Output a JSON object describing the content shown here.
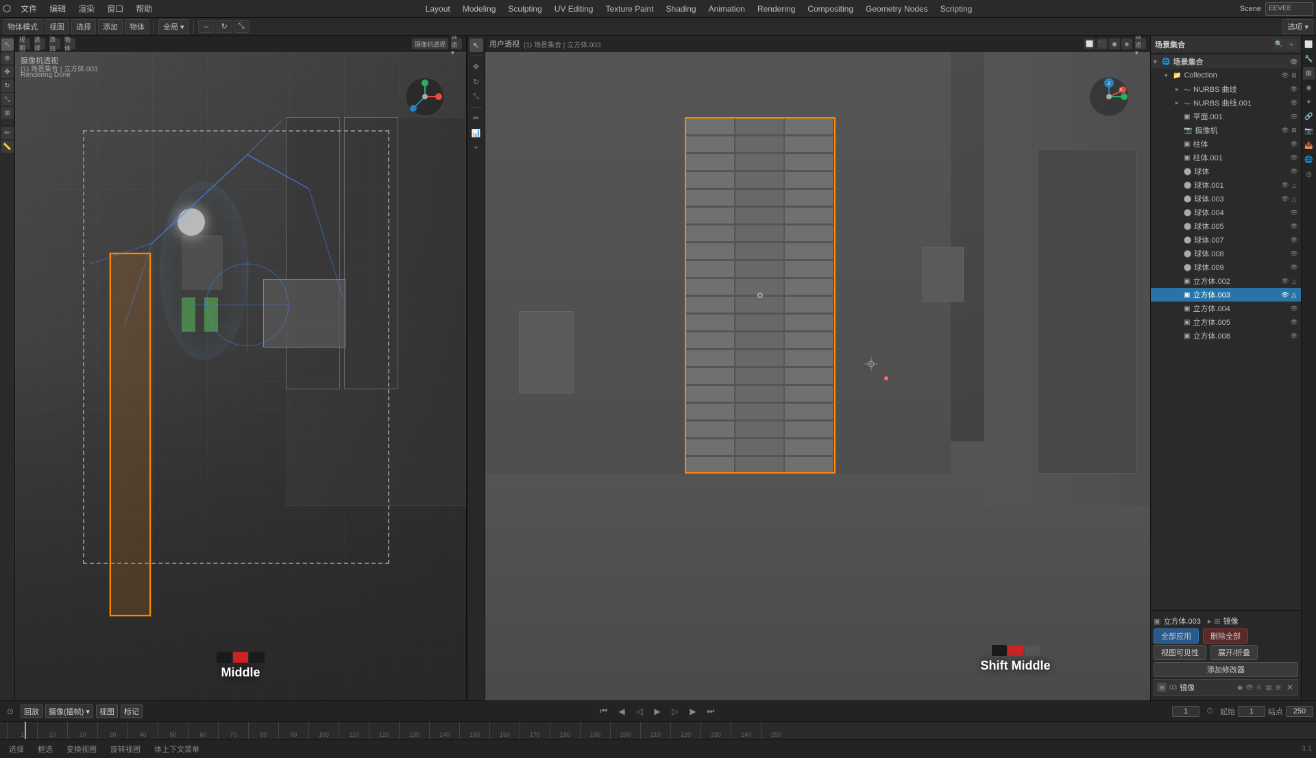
{
  "app": {
    "title": "Blender",
    "version": "3.1"
  },
  "top_menu": {
    "items": [
      "文件",
      "编辑",
      "渲染",
      "窗口",
      "帮助",
      "Layout",
      "Modeling",
      "Sculpting",
      "UV Editing",
      "Texture Paint",
      "Shading",
      "Animation",
      "Rendering",
      "Compositing",
      "Geometry Nodes",
      "Scripting"
    ]
  },
  "toolbar_left": {
    "mode_label": "物体模式",
    "view_label": "视图",
    "select_label": "选择",
    "add_label": "添加",
    "object_label": "物体"
  },
  "viewport_left": {
    "title": "摄像机透视",
    "subtitle": "(1) 场景集合 | 立方体.003",
    "status": "Rendering Done",
    "mode": "摄像机透视"
  },
  "viewport_right": {
    "title": "用户透视",
    "subtitle": "(1) 场景集合 | 立方体.003"
  },
  "timeline": {
    "mode": "回放",
    "mode2": "摄像(插帧)",
    "view": "视图",
    "marker": "标记",
    "start_frame": "1",
    "end_frame": "250",
    "current_frame": "1",
    "keyframe_label": "起始",
    "keyframe_start": "1",
    "keyframe_end": "结点",
    "keyframe_end_val": "250",
    "frame_marks": [
      "1",
      "10",
      "20",
      "30",
      "40",
      "50",
      "60",
      "70",
      "80",
      "90",
      "100",
      "110",
      "120",
      "130",
      "140",
      "150",
      "160",
      "170",
      "180",
      "190",
      "200",
      "210",
      "220",
      "230",
      "240",
      "250"
    ]
  },
  "mouse_hints": {
    "left_label": "Middle",
    "right_label": "Shift Middle"
  },
  "scene_tree": {
    "header": "场景集合",
    "items": [
      {
        "id": "collection",
        "label": "Collection",
        "depth": 0,
        "expanded": true,
        "type": "collection"
      },
      {
        "id": "nurbs_line",
        "label": "NURBS 曲线",
        "depth": 1,
        "expanded": false,
        "type": "curve"
      },
      {
        "id": "nurbs_001",
        "label": "NURBS 曲线.001",
        "depth": 1,
        "expanded": false,
        "type": "curve"
      },
      {
        "id": "plane_001",
        "label": "平面.001",
        "depth": 1,
        "expanded": false,
        "type": "mesh"
      },
      {
        "id": "camera",
        "label": "摄像机",
        "depth": 1,
        "expanded": false,
        "type": "camera"
      },
      {
        "id": "column",
        "label": "柱体",
        "depth": 1,
        "expanded": false,
        "type": "mesh"
      },
      {
        "id": "column_001",
        "label": "柱体.001",
        "depth": 1,
        "expanded": false,
        "type": "mesh"
      },
      {
        "id": "sphere_body",
        "label": "球体",
        "depth": 1,
        "expanded": false,
        "type": "mesh"
      },
      {
        "id": "sphere_001",
        "label": "球体.001",
        "depth": 1,
        "expanded": false,
        "type": "mesh"
      },
      {
        "id": "sphere_003",
        "label": "球体.003",
        "depth": 1,
        "expanded": false,
        "type": "mesh"
      },
      {
        "id": "sphere_004",
        "label": "球体.004",
        "depth": 1,
        "expanded": false,
        "type": "mesh"
      },
      {
        "id": "sphere_005",
        "label": "球体.005",
        "depth": 1,
        "expanded": false,
        "type": "mesh"
      },
      {
        "id": "sphere_007",
        "label": "球体.007",
        "depth": 1,
        "expanded": false,
        "type": "mesh"
      },
      {
        "id": "sphere_008",
        "label": "球体.008",
        "depth": 1,
        "expanded": false,
        "type": "mesh"
      },
      {
        "id": "sphere_009",
        "label": "球体.009",
        "depth": 1,
        "expanded": false,
        "type": "mesh"
      },
      {
        "id": "cube_002",
        "label": "立方体.002",
        "depth": 1,
        "expanded": false,
        "type": "mesh"
      },
      {
        "id": "cube_003",
        "label": "立方体.003",
        "depth": 1,
        "expanded": false,
        "type": "mesh",
        "selected": true,
        "active": true
      },
      {
        "id": "cube_004",
        "label": "立方体.004",
        "depth": 1,
        "expanded": false,
        "type": "mesh"
      },
      {
        "id": "cube_005",
        "label": "立方体.005",
        "depth": 1,
        "expanded": false,
        "type": "mesh"
      },
      {
        "id": "cube_008",
        "label": "立方体.008",
        "depth": 1,
        "expanded": false,
        "type": "mesh"
      }
    ]
  },
  "properties": {
    "object_name": "立方体.003",
    "modifier_name": "镜像",
    "apply_all_label": "全部应用",
    "view_visibility_label": "视图可见性",
    "expand_label": "展开/折叠",
    "delete_label": "删除全部",
    "add_modifier_label": "添加修改器"
  },
  "bottom_bar": {
    "items": [
      "选择",
      "框选",
      "变换视图",
      "旋转视图",
      "体上下文菜单"
    ]
  },
  "colors": {
    "selection_orange": "#ff8800",
    "active_blue": "#2874a6",
    "gizmo_x": "#e74c3c",
    "gizmo_y": "#27ae60",
    "gizmo_z": "#2980b9",
    "bg_dark": "#1a1a1a",
    "panel_bg": "#2a2a2a"
  }
}
